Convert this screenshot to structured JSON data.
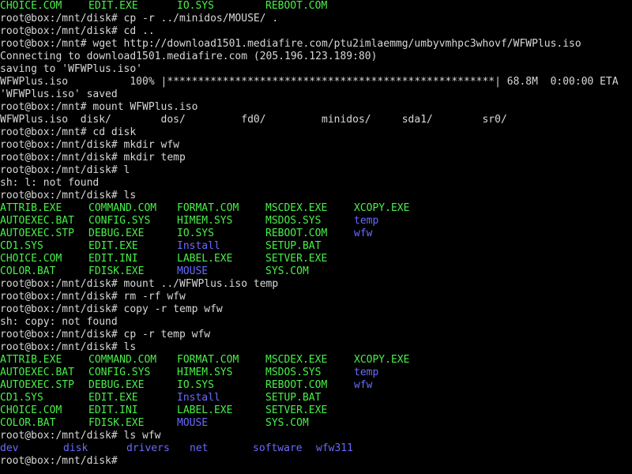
{
  "terminal": {
    "colors": {
      "background": "#000000",
      "text": "#d8d8d8",
      "executable": "#48f048",
      "directory": "#6a6aff"
    },
    "lines": [
      {
        "segs": [
          {
            "t": "CHOICE.COM",
            "c": "exe",
            "col": 0
          },
          {
            "t": "EDIT.EXE",
            "c": "exe",
            "col": 14
          },
          {
            "t": "IO.SYS",
            "c": "exe",
            "col": 28
          },
          {
            "t": "REBOOT.COM",
            "c": "exe",
            "col": 42
          }
        ]
      },
      {
        "segs": [
          {
            "t": "root@box:/mnt/disk# cp -r ../minidos/MOUSE/ .",
            "c": "text",
            "col": 0
          }
        ]
      },
      {
        "segs": [
          {
            "t": "root@box:/mnt/disk# cd ..",
            "c": "text",
            "col": 0
          }
        ]
      },
      {
        "segs": [
          {
            "t": "root@box:/mnt# wget http://download1501.mediafire.com/ptu2imlaemmg/umbyvmhpc3whovf/WFWPlus.iso",
            "c": "text",
            "col": 0
          }
        ]
      },
      {
        "segs": [
          {
            "t": "Connecting to download1501.mediafire.com (205.196.123.189:80)",
            "c": "text",
            "col": 0
          }
        ]
      },
      {
        "segs": [
          {
            "t": "saving to 'WFWPlus.iso'",
            "c": "text",
            "col": 0
          }
        ]
      },
      {
        "segs": [
          {
            "t": "WFWPlus.iso          100% |*****************************************************| 68.8M  0:00:00 ETA",
            "c": "text",
            "col": 0
          }
        ]
      },
      {
        "segs": [
          {
            "t": "'WFWPlus.iso' saved",
            "c": "text",
            "col": 0
          }
        ]
      },
      {
        "segs": [
          {
            "t": "root@box:/mnt# mount WFWPlus.iso",
            "c": "text",
            "col": 0
          }
        ]
      },
      {
        "segs": [
          {
            "t": "WFWPlus.iso  disk/        dos/         fd0/         minidos/     sda1/        sr0/",
            "c": "text",
            "col": 0
          }
        ]
      },
      {
        "segs": [
          {
            "t": "root@box:/mnt# cd disk",
            "c": "text",
            "col": 0
          }
        ]
      },
      {
        "segs": [
          {
            "t": "root@box:/mnt/disk# mkdir wfw",
            "c": "text",
            "col": 0
          }
        ]
      },
      {
        "segs": [
          {
            "t": "root@box:/mnt/disk# mkdir temp",
            "c": "text",
            "col": 0
          }
        ]
      },
      {
        "segs": [
          {
            "t": "root@box:/mnt/disk# l",
            "c": "text",
            "col": 0
          }
        ]
      },
      {
        "segs": [
          {
            "t": "sh: l: not found",
            "c": "text",
            "col": 0
          }
        ]
      },
      {
        "segs": [
          {
            "t": "root@box:/mnt/disk# ls",
            "c": "text",
            "col": 0
          }
        ]
      },
      {
        "segs": [
          {
            "t": "ATTRIB.EXE",
            "c": "exe",
            "col": 0
          },
          {
            "t": "COMMAND.COM",
            "c": "exe",
            "col": 14
          },
          {
            "t": "FORMAT.COM",
            "c": "exe",
            "col": 28
          },
          {
            "t": "MSCDEX.EXE",
            "c": "exe",
            "col": 42
          },
          {
            "t": "XCOPY.EXE",
            "c": "exe",
            "col": 56
          }
        ]
      },
      {
        "segs": [
          {
            "t": "AUTOEXEC.BAT",
            "c": "exe",
            "col": 0
          },
          {
            "t": "CONFIG.SYS",
            "c": "exe",
            "col": 14
          },
          {
            "t": "HIMEM.SYS",
            "c": "exe",
            "col": 28
          },
          {
            "t": "MSDOS.SYS",
            "c": "exe",
            "col": 42
          },
          {
            "t": "temp",
            "c": "dir",
            "col": 56
          }
        ]
      },
      {
        "segs": [
          {
            "t": "AUTOEXEC.STP",
            "c": "exe",
            "col": 0
          },
          {
            "t": "DEBUG.EXE",
            "c": "exe",
            "col": 14
          },
          {
            "t": "IO.SYS",
            "c": "exe",
            "col": 28
          },
          {
            "t": "REBOOT.COM",
            "c": "exe",
            "col": 42
          },
          {
            "t": "wfw",
            "c": "dir",
            "col": 56
          }
        ]
      },
      {
        "segs": [
          {
            "t": "CD1.SYS",
            "c": "exe",
            "col": 0
          },
          {
            "t": "EDIT.EXE",
            "c": "exe",
            "col": 14
          },
          {
            "t": "Install",
            "c": "dir",
            "col": 28
          },
          {
            "t": "SETUP.BAT",
            "c": "exe",
            "col": 42
          }
        ]
      },
      {
        "segs": [
          {
            "t": "CHOICE.COM",
            "c": "exe",
            "col": 0
          },
          {
            "t": "EDIT.INI",
            "c": "exe",
            "col": 14
          },
          {
            "t": "LABEL.EXE",
            "c": "exe",
            "col": 28
          },
          {
            "t": "SETVER.EXE",
            "c": "exe",
            "col": 42
          }
        ]
      },
      {
        "segs": [
          {
            "t": "COLOR.BAT",
            "c": "exe",
            "col": 0
          },
          {
            "t": "FDISK.EXE",
            "c": "exe",
            "col": 14
          },
          {
            "t": "MOUSE",
            "c": "dir",
            "col": 28
          },
          {
            "t": "SYS.COM",
            "c": "exe",
            "col": 42
          }
        ]
      },
      {
        "segs": [
          {
            "t": "root@box:/mnt/disk# mount ../WFWPlus.iso temp",
            "c": "text",
            "col": 0
          }
        ]
      },
      {
        "segs": [
          {
            "t": "root@box:/mnt/disk# rm -rf wfw",
            "c": "text",
            "col": 0
          }
        ]
      },
      {
        "segs": [
          {
            "t": "root@box:/mnt/disk# copy -r temp wfw",
            "c": "text",
            "col": 0
          }
        ]
      },
      {
        "segs": [
          {
            "t": "sh: copy: not found",
            "c": "text",
            "col": 0
          }
        ]
      },
      {
        "segs": [
          {
            "t": "root@box:/mnt/disk# cp -r temp wfw",
            "c": "text",
            "col": 0
          }
        ]
      },
      {
        "segs": [
          {
            "t": "root@box:/mnt/disk# ls",
            "c": "text",
            "col": 0
          }
        ]
      },
      {
        "segs": [
          {
            "t": "ATTRIB.EXE",
            "c": "exe",
            "col": 0
          },
          {
            "t": "COMMAND.COM",
            "c": "exe",
            "col": 14
          },
          {
            "t": "FORMAT.COM",
            "c": "exe",
            "col": 28
          },
          {
            "t": "MSCDEX.EXE",
            "c": "exe",
            "col": 42
          },
          {
            "t": "XCOPY.EXE",
            "c": "exe",
            "col": 56
          }
        ]
      },
      {
        "segs": [
          {
            "t": "AUTOEXEC.BAT",
            "c": "exe",
            "col": 0
          },
          {
            "t": "CONFIG.SYS",
            "c": "exe",
            "col": 14
          },
          {
            "t": "HIMEM.SYS",
            "c": "exe",
            "col": 28
          },
          {
            "t": "MSDOS.SYS",
            "c": "exe",
            "col": 42
          },
          {
            "t": "temp",
            "c": "dir",
            "col": 56
          }
        ]
      },
      {
        "segs": [
          {
            "t": "AUTOEXEC.STP",
            "c": "exe",
            "col": 0
          },
          {
            "t": "DEBUG.EXE",
            "c": "exe",
            "col": 14
          },
          {
            "t": "IO.SYS",
            "c": "exe",
            "col": 28
          },
          {
            "t": "REBOOT.COM",
            "c": "exe",
            "col": 42
          },
          {
            "t": "wfw",
            "c": "dir",
            "col": 56
          }
        ]
      },
      {
        "segs": [
          {
            "t": "CD1.SYS",
            "c": "exe",
            "col": 0
          },
          {
            "t": "EDIT.EXE",
            "c": "exe",
            "col": 14
          },
          {
            "t": "Install",
            "c": "dir",
            "col": 28
          },
          {
            "t": "SETUP.BAT",
            "c": "exe",
            "col": 42
          }
        ]
      },
      {
        "segs": [
          {
            "t": "CHOICE.COM",
            "c": "exe",
            "col": 0
          },
          {
            "t": "EDIT.INI",
            "c": "exe",
            "col": 14
          },
          {
            "t": "LABEL.EXE",
            "c": "exe",
            "col": 28
          },
          {
            "t": "SETVER.EXE",
            "c": "exe",
            "col": 42
          }
        ]
      },
      {
        "segs": [
          {
            "t": "COLOR.BAT",
            "c": "exe",
            "col": 0
          },
          {
            "t": "FDISK.EXE",
            "c": "exe",
            "col": 14
          },
          {
            "t": "MOUSE",
            "c": "dir",
            "col": 28
          },
          {
            "t": "SYS.COM",
            "c": "exe",
            "col": 42
          }
        ]
      },
      {
        "segs": [
          {
            "t": "root@box:/mnt/disk# ls wfw",
            "c": "text",
            "col": 0
          }
        ]
      },
      {
        "segs": [
          {
            "t": "dev",
            "c": "dir",
            "col": 0
          },
          {
            "t": "disk",
            "c": "dir",
            "col": 10
          },
          {
            "t": "drivers",
            "c": "dir",
            "col": 20
          },
          {
            "t": "net",
            "c": "dir",
            "col": 30
          },
          {
            "t": "software",
            "c": "dir",
            "col": 40
          },
          {
            "t": "wfw311",
            "c": "dir",
            "col": 50
          }
        ]
      },
      {
        "segs": [
          {
            "t": "root@box:/mnt/disk#",
            "c": "text",
            "col": 0
          }
        ]
      }
    ]
  }
}
